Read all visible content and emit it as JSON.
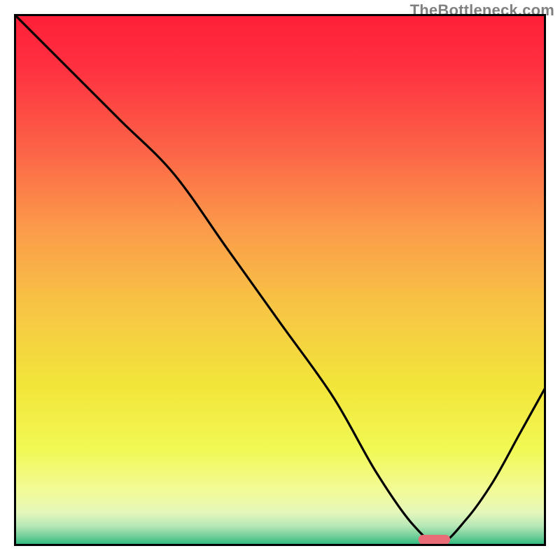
{
  "watermark": "TheBottleneck.com",
  "chart_data": {
    "type": "line",
    "title": "",
    "xlabel": "",
    "ylabel": "",
    "xlim": [
      0,
      100
    ],
    "ylim": [
      0,
      100
    ],
    "grid": false,
    "legend": false,
    "series": [
      {
        "name": "curve",
        "color": "#000000",
        "x": [
          0,
          10,
          20,
          30,
          40,
          50,
          60,
          68,
          75,
          80,
          85,
          90,
          95,
          100
        ],
        "y": [
          100,
          90,
          80,
          70,
          56,
          42,
          28,
          14,
          4,
          0.5,
          5,
          12,
          21,
          30
        ]
      }
    ],
    "marker": {
      "name": "optimal-region",
      "color": "#e86d76",
      "x_start": 76,
      "x_end": 82,
      "y": 1.2,
      "height": 1.8
    },
    "background": {
      "type": "vertical-gradient",
      "stops": [
        {
          "pos": 0.0,
          "color": "#fe1f38"
        },
        {
          "pos": 0.1,
          "color": "#fe3140"
        },
        {
          "pos": 0.25,
          "color": "#fc6247"
        },
        {
          "pos": 0.4,
          "color": "#fb9a4a"
        },
        {
          "pos": 0.55,
          "color": "#f7c544"
        },
        {
          "pos": 0.7,
          "color": "#f2e53a"
        },
        {
          "pos": 0.82,
          "color": "#f1f953"
        },
        {
          "pos": 0.9,
          "color": "#f2fb98"
        },
        {
          "pos": 0.94,
          "color": "#e5f7ba"
        },
        {
          "pos": 0.965,
          "color": "#b9e8b7"
        },
        {
          "pos": 0.985,
          "color": "#74d09b"
        },
        {
          "pos": 1.0,
          "color": "#31bb7f"
        }
      ]
    }
  }
}
